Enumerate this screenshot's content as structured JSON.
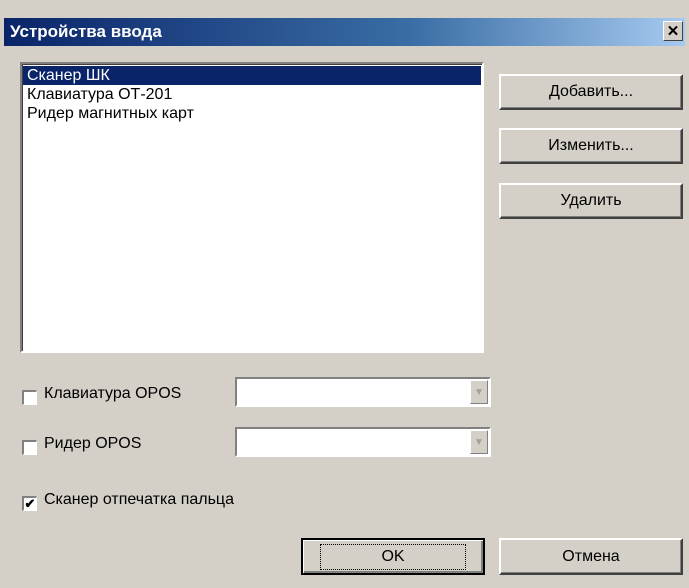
{
  "window": {
    "title": "Устройства ввода",
    "close_glyph": "✕"
  },
  "devices": {
    "items": [
      "Сканер ШК",
      "Клавиатура ОТ-201",
      "Ридер магнитных карт"
    ],
    "selected_index": 0
  },
  "buttons": {
    "add": "Добавить...",
    "edit": "Изменить...",
    "delete": "Удалить",
    "ok": "OK",
    "cancel": "Отмена"
  },
  "options": {
    "keyboard_opos": {
      "label": "Клавиатура OPOS",
      "checked": false,
      "value": ""
    },
    "reader_opos": {
      "label": "Ридер OPOS",
      "checked": false,
      "value": ""
    },
    "fingerprint": {
      "label": "Сканер отпечатка пальца",
      "checked": true,
      "check_glyph": "✔"
    }
  },
  "colors": {
    "title_gradient_start": "#0a246a",
    "title_gradient_end": "#a6caf0",
    "selection": "#0a246a",
    "face": "#d4d0c8"
  }
}
